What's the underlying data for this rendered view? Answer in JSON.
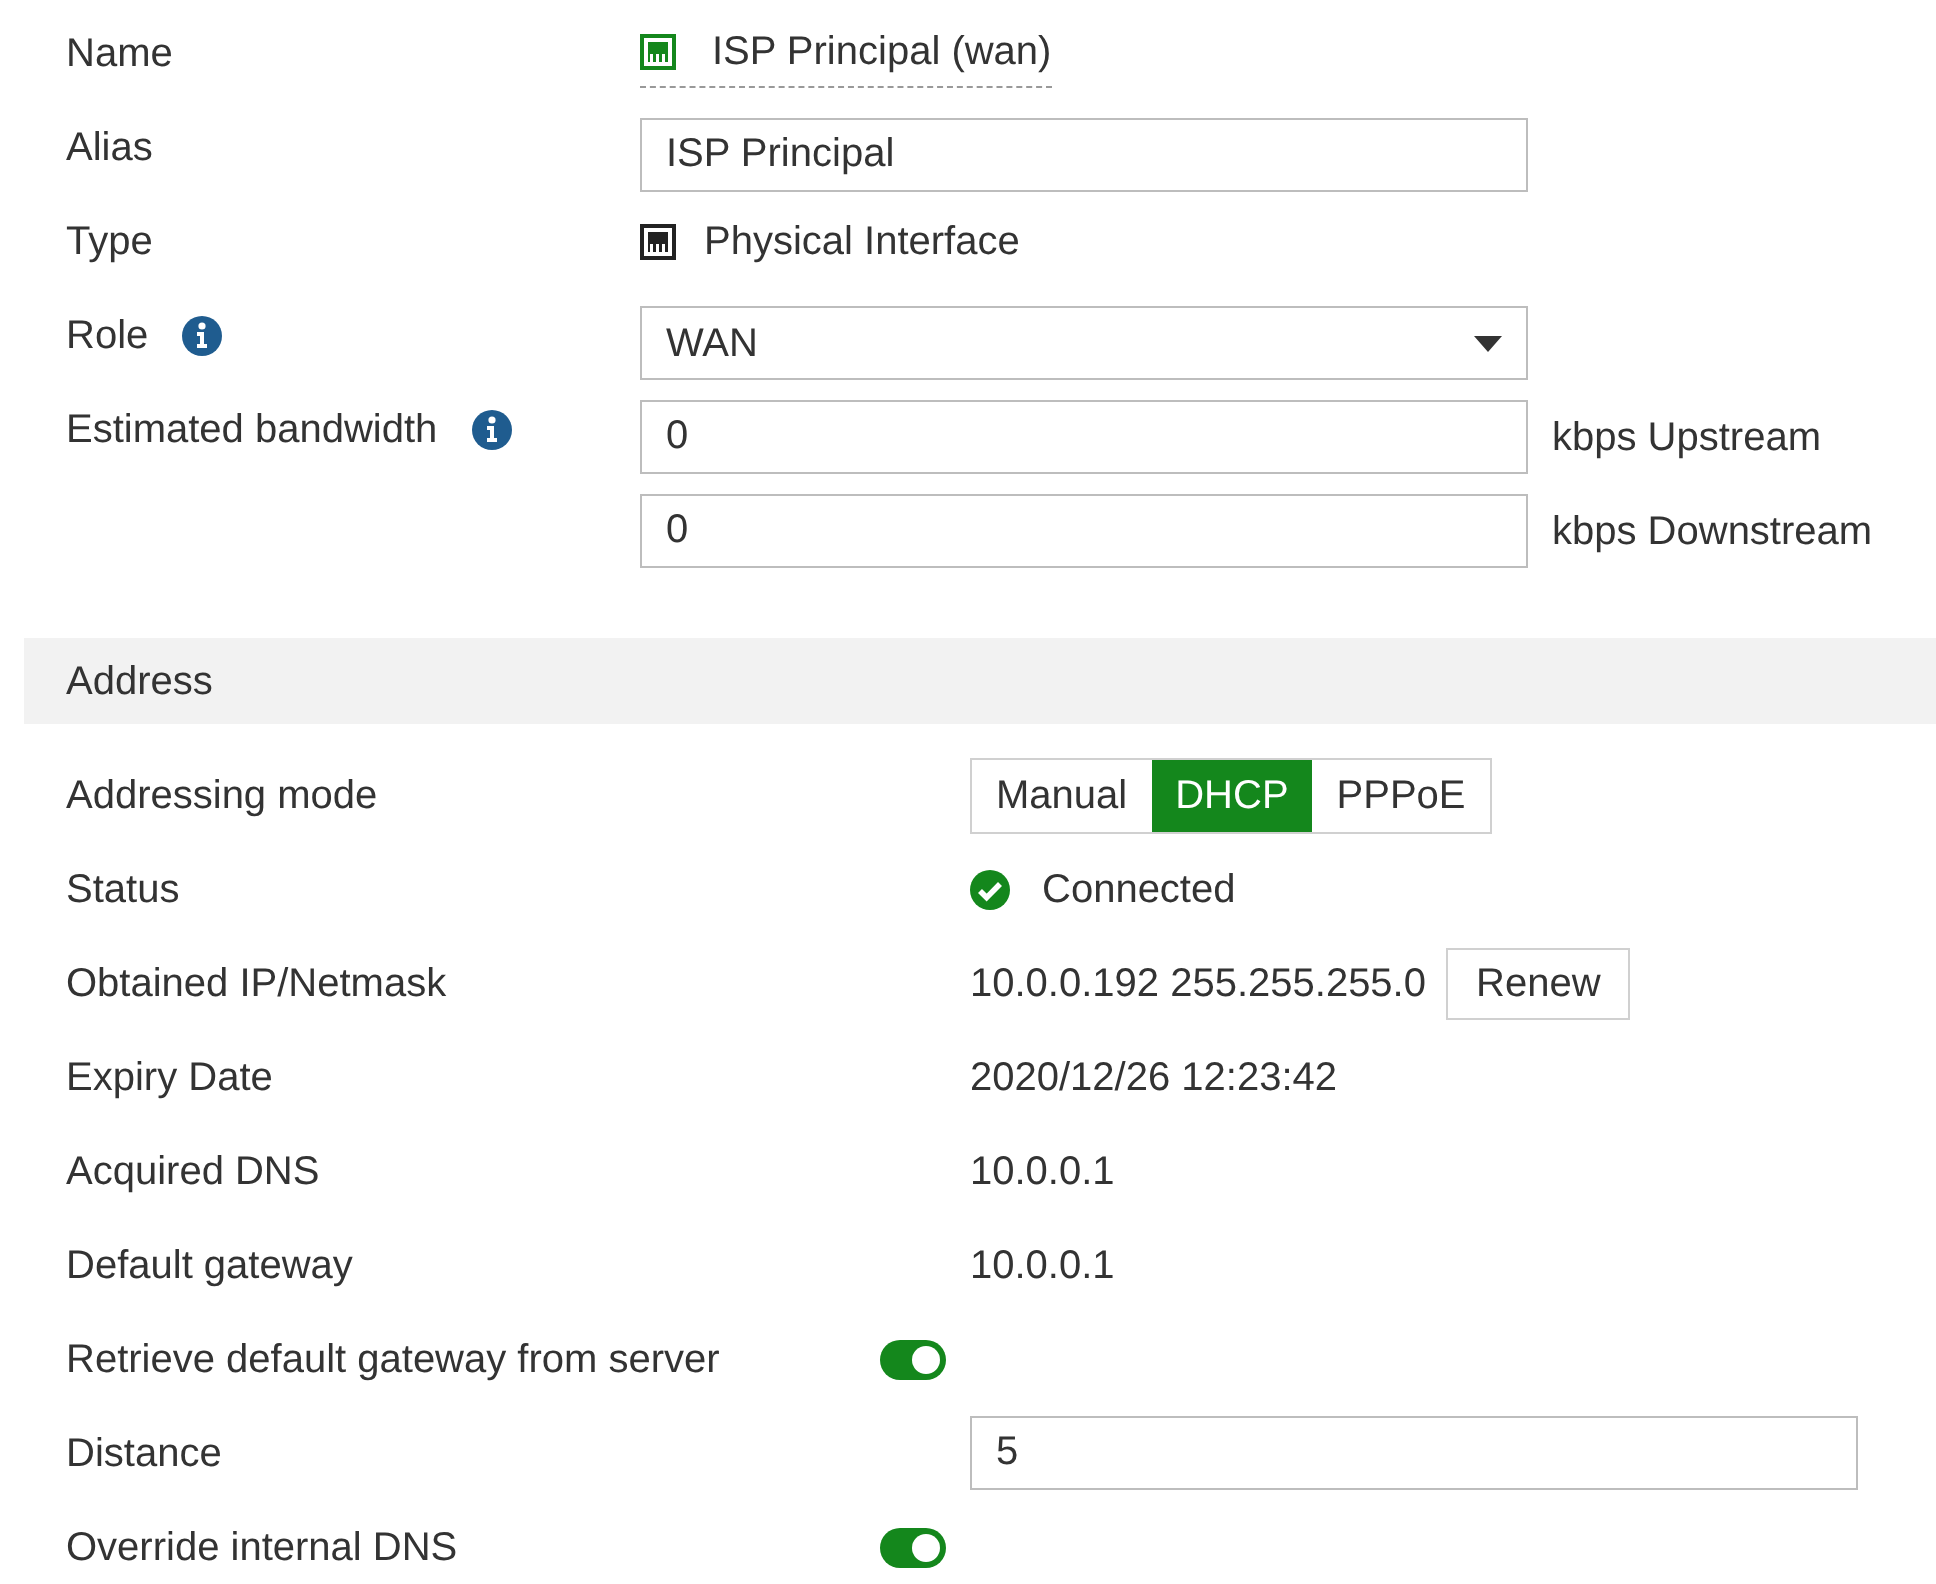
{
  "interface": [
    {
      "kind": "link",
      "label": "Name",
      "value": "ISP Principal (wan)"
    },
    {
      "kind": "input",
      "label": "Alias",
      "value": "ISP Principal"
    },
    {
      "kind": "port",
      "label": "Type",
      "value": "Physical Interface"
    },
    {
      "kind": "select",
      "label": "Role",
      "info": true,
      "value": "WAN"
    },
    {
      "kind": "input-unit",
      "label": "Estimated bandwidth",
      "info": true,
      "value": "0",
      "unit": "kbps Upstream"
    },
    {
      "kind": "input-unit",
      "value": "0",
      "unit": "kbps Downstream"
    }
  ],
  "address": {
    "title": "Address",
    "rows": [
      {
        "kind": "segmented",
        "label": "Addressing mode",
        "options": [
          {
            "label": "Manual",
            "selected": false
          },
          {
            "label": "DHCP",
            "selected": true
          },
          {
            "label": "PPPoE",
            "selected": false
          }
        ]
      },
      {
        "kind": "status",
        "label": "Status",
        "value": "Connected"
      },
      {
        "kind": "text-button",
        "label": "Obtained IP/Netmask",
        "value": "10.0.0.192 255.255.255.0",
        "button": "Renew"
      },
      {
        "kind": "text",
        "label": "Expiry Date",
        "value": "2020/12/26 12:23:42"
      },
      {
        "kind": "text",
        "label": "Acquired DNS",
        "value": "10.0.0.1"
      },
      {
        "kind": "text",
        "label": "Default gateway",
        "value": "10.0.0.1"
      },
      {
        "kind": "toggle",
        "label": "Retrieve default gateway from server",
        "on": true
      },
      {
        "kind": "input",
        "label": "Distance",
        "value": "5"
      },
      {
        "kind": "toggle",
        "label": "Override internal DNS",
        "on": true
      }
    ]
  }
}
